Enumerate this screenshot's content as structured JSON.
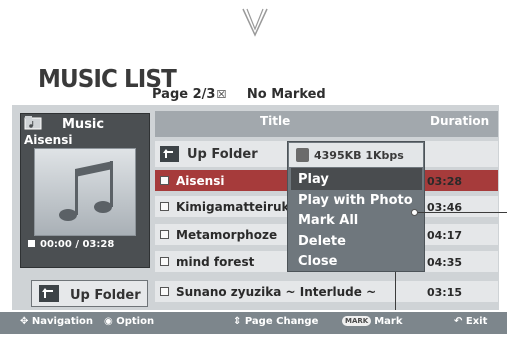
{
  "header": {
    "title": "MUSIC LIST",
    "page": "Page 2/3",
    "marked": "No Marked"
  },
  "info_panel": {
    "label": "Music",
    "artist": "Aisensi",
    "time": "00:00 / 03:28",
    "icon": "music-folder-icon"
  },
  "up_folder_button": {
    "label": "Up Folder",
    "icon": "up-folder-icon"
  },
  "table": {
    "columns": [
      "Title",
      "Duration"
    ],
    "up_folder_row": "Up Folder",
    "rows": [
      {
        "title": "Aisensi",
        "duration": "03:28",
        "selected": true
      },
      {
        "title": "Kimigamatteirukara",
        "duration": "03:46",
        "selected": false
      },
      {
        "title": "Metamorphoze",
        "duration": "04:17",
        "selected": false
      },
      {
        "title": "mind forest",
        "duration": "04:35",
        "selected": false
      },
      {
        "title": "Sunano zyuzika ~ Interlude ~",
        "duration": "03:15",
        "selected": false
      }
    ]
  },
  "popup": {
    "info": "4395KB 1Kbps",
    "items": [
      "Play",
      "Play with Photo",
      "Mark All",
      "Delete",
      "Close"
    ],
    "selected": "Play"
  },
  "footer": {
    "navigation": "Navigation",
    "option": "Option",
    "page_change": "Page Change",
    "mark_badge": "MARK",
    "mark": "Mark",
    "exit": "Exit"
  },
  "colors": {
    "selected_row": "#a63b3b",
    "panel_bg": "#cfd3d6",
    "bottom_bar": "#7d868c"
  }
}
